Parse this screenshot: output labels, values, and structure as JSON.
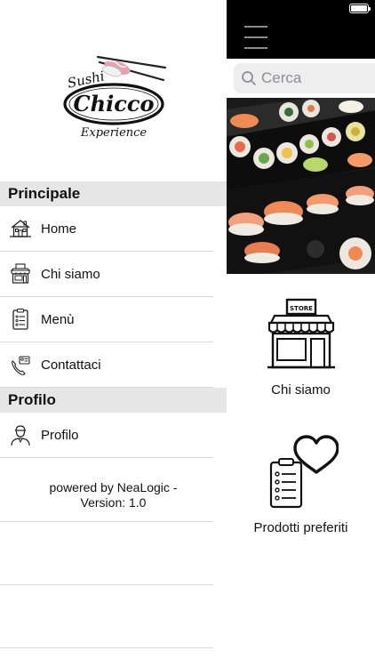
{
  "app": {
    "brand": {
      "line1": "Sushi",
      "line2": "Chicco",
      "line3": "Experience"
    }
  },
  "status_bar": {
    "battery_icon": "battery-icon",
    "battery_level": 1.0
  },
  "drawer": {
    "sections": [
      {
        "header": "Principale",
        "items": [
          {
            "label": "Home",
            "icon": "house-icon"
          },
          {
            "label": "Chi siamo",
            "icon": "store-icon"
          },
          {
            "label": "Menù",
            "icon": "menu-list-icon"
          },
          {
            "label": "Contattaci",
            "icon": "phone-contact-icon"
          }
        ]
      },
      {
        "header": "Profilo",
        "items": [
          {
            "label": "Profilo",
            "icon": "user-icon"
          }
        ]
      }
    ],
    "powered_line1": "powered by NeaLogic -",
    "powered_line2": "Version: 1.0"
  },
  "main": {
    "menu_icon": "hamburger-icon",
    "search": {
      "placeholder": "Cerca",
      "icon": "search-icon"
    },
    "cards": [
      {
        "label": "Chi siamo",
        "icon": "store-icon"
      },
      {
        "label": "Prodotti preferiti",
        "icon": "favorites-clipboard-icon"
      }
    ]
  },
  "colors": {
    "topbar": "#000000",
    "section_header_bg": "#e6e6e6",
    "search_bg": "#eeeeef",
    "brand_pink": "#e7a3ad",
    "text": "#111111"
  }
}
